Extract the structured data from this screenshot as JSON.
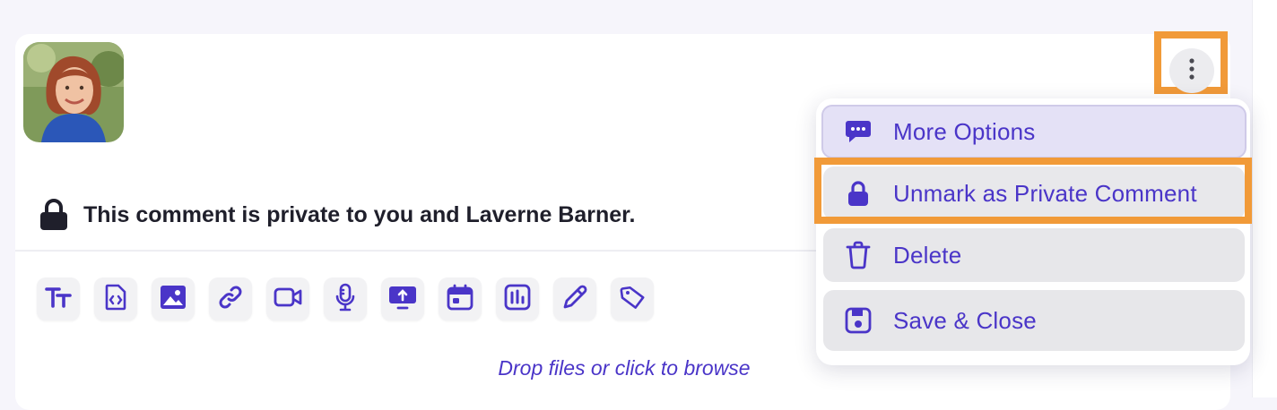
{
  "comment": {
    "author_avatar": "avatar",
    "private_notice": "This comment is private to you and Laverne Barner."
  },
  "toolbar": {
    "tools": [
      {
        "name": "text-format-icon"
      },
      {
        "name": "code-file-icon"
      },
      {
        "name": "image-icon"
      },
      {
        "name": "link-icon"
      },
      {
        "name": "video-icon"
      },
      {
        "name": "microphone-icon"
      },
      {
        "name": "screen-share-icon"
      },
      {
        "name": "calendar-icon"
      },
      {
        "name": "poll-icon"
      },
      {
        "name": "pencil-icon"
      },
      {
        "name": "tag-icon"
      }
    ]
  },
  "dropzone": {
    "label": "Drop files or click to browse"
  },
  "menu": {
    "items": [
      {
        "label": "More Options",
        "icon": "chat-bubble-icon"
      },
      {
        "label": "Unmark as Private Comment",
        "icon": "lock-icon"
      },
      {
        "label": "Delete",
        "icon": "trash-icon"
      },
      {
        "label": "Save & Close",
        "icon": "save-icon"
      }
    ]
  },
  "colors": {
    "accent": "#4a35c8",
    "highlight": "#f19a38"
  }
}
